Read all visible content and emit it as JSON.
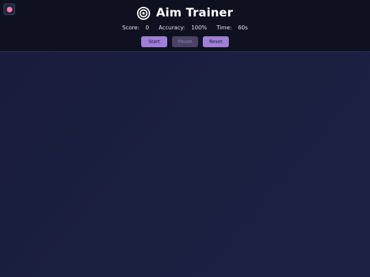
{
  "header": {
    "title": "Aim Trainer",
    "icon": "target-icon",
    "corner_icon": "record-dot-icon",
    "stats": {
      "score_label": "Score:",
      "score_value": "0",
      "accuracy_label": "Accuracy:",
      "accuracy_value": "100%",
      "time_label": "Time:",
      "time_value": "60s"
    },
    "buttons": {
      "start": "Start",
      "pause": "Pause",
      "reset": "Reset"
    }
  },
  "colors": {
    "header_bg": "#0f1120",
    "play_area_bg": "#1b2040",
    "button_accent": "#a07fd6",
    "button_disabled": "#4b4266",
    "corner_dot": "#f07ea7"
  }
}
